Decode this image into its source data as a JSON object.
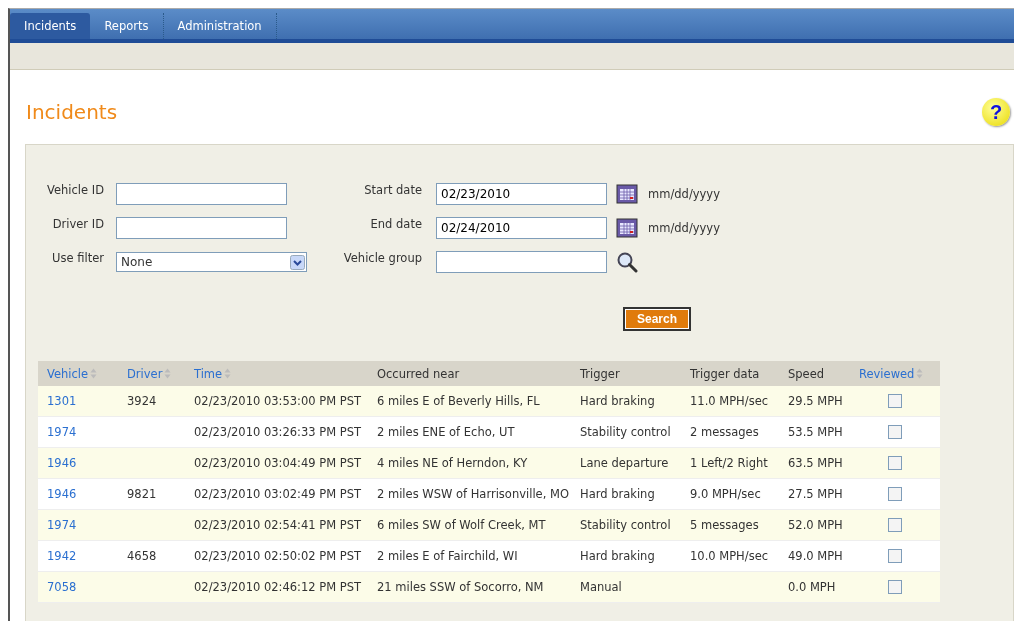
{
  "tabs": [
    {
      "label": "Incidents",
      "selected": true
    },
    {
      "label": "Reports",
      "selected": false
    },
    {
      "label": "Administration",
      "selected": false
    }
  ],
  "page_title": "Incidents",
  "help_button": {
    "label": "?"
  },
  "form": {
    "vehicle_id": {
      "label": "Vehicle ID"
    },
    "driver_id": {
      "label": "Driver ID"
    },
    "use_filter": {
      "label": "Use filter",
      "value": "None"
    },
    "start_date": {
      "label": "Start date",
      "value": "02/23/2010",
      "format": "mm/dd/yyyy"
    },
    "end_date": {
      "label": "End date",
      "value": "02/24/2010",
      "format": "mm/dd/yyyy"
    },
    "vehicle_group": {
      "label": "Vehicle group"
    },
    "search_button": "Search"
  },
  "table": {
    "columns": [
      {
        "label": "Vehicle",
        "sortable": true
      },
      {
        "label": "Driver",
        "sortable": true
      },
      {
        "label": "Time",
        "sortable": true
      },
      {
        "label": "Occurred near",
        "sortable": false
      },
      {
        "label": "Trigger",
        "sortable": false
      },
      {
        "label": "Trigger data",
        "sortable": false
      },
      {
        "label": "Speed",
        "sortable": false
      },
      {
        "label": "Reviewed",
        "sortable": true
      }
    ],
    "rows": [
      {
        "vehicle": "1301",
        "driver": "3924",
        "time": "02/23/2010 03:53:00 PM PST",
        "occurred_near": "6 miles E of Beverly Hills, FL",
        "trigger": "Hard braking",
        "trigger_data": "11.0 MPH/sec",
        "speed": "29.5 MPH",
        "reviewed": false
      },
      {
        "vehicle": "1974",
        "time": "02/23/2010 03:26:33 PM PST",
        "occurred_near": "2 miles ENE of Echo, UT",
        "trigger": "Stability control",
        "trigger_data": "2 messages",
        "speed": "53.5 MPH",
        "reviewed": false
      },
      {
        "vehicle": "1946",
        "time": "02/23/2010 03:04:49 PM PST",
        "occurred_near": "4 miles NE of Herndon, KY",
        "trigger": "Lane departure",
        "trigger_data": "1 Left/2 Right",
        "speed": "63.5 MPH",
        "reviewed": false
      },
      {
        "vehicle": "1946",
        "driver": "9821",
        "time": "02/23/2010 03:02:49 PM PST",
        "occurred_near": "2 miles WSW of Harrisonville, MO",
        "trigger": "Hard braking",
        "trigger_data": "9.0 MPH/sec",
        "speed": "27.5 MPH",
        "reviewed": false
      },
      {
        "vehicle": "1974",
        "time": "02/23/2010 02:54:41 PM PST",
        "occurred_near": "6 miles SW of Wolf Creek, MT",
        "trigger": "Stability control",
        "trigger_data": "5 messages",
        "speed": "52.0 MPH",
        "reviewed": false
      },
      {
        "vehicle": "1942",
        "driver": "4658",
        "time": "02/23/2010 02:50:02 PM PST",
        "occurred_near": "2 miles E of Fairchild, WI",
        "trigger": "Hard braking",
        "trigger_data": "10.0 MPH/sec",
        "speed": "49.0 MPH",
        "reviewed": false
      },
      {
        "vehicle": "7058",
        "time": "02/23/2010 02:46:12 PM PST",
        "occurred_near": "21 miles SSW of Socorro, NM",
        "trigger": "Manual",
        "speed": "0.0 MPH",
        "reviewed": false
      }
    ]
  }
}
